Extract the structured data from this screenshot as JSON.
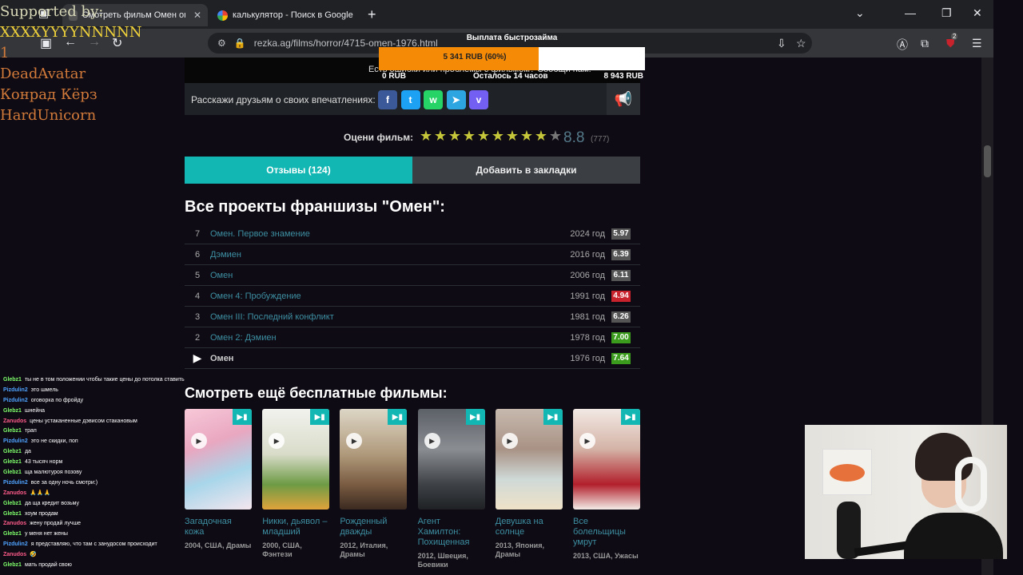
{
  "browser": {
    "tabs": [
      {
        "label": "Смотреть фильм Омен онлайн"
      },
      {
        "label": "калькулятор - Поиск в Google"
      }
    ],
    "new_tab": "+",
    "url": "rezka.ag/films/horror/4715-omen-1976.html",
    "extension_badge": "2"
  },
  "page": {
    "report_text": "Есть ошибки или проблемы с фильмом? Сообщи нам!",
    "share_label": "Расскажи друзьям о своих впечатлениях:",
    "social": [
      {
        "name": "facebook",
        "glyph": "f",
        "color": "#3b5998"
      },
      {
        "name": "twitter",
        "glyph": "t",
        "color": "#1da1f2"
      },
      {
        "name": "whatsapp",
        "glyph": "w",
        "color": "#25d366"
      },
      {
        "name": "telegram",
        "glyph": "➤",
        "color": "#2ca5e0"
      },
      {
        "name": "viber",
        "glyph": "v",
        "color": "#7360f2"
      }
    ],
    "rating_label": "Оцени фильм:",
    "rating_value": "8.8",
    "rating_count": "(777)",
    "rating_stars_filled": 9,
    "rating_stars_total": 10,
    "tab_reviews": "Отзывы (124)",
    "tab_bookmark": "Добавить в закладки",
    "franchise_title": "Все проекты франшизы \"Омен\":",
    "franchise": [
      {
        "num": "7",
        "title": "Омен. Первое знамение",
        "year": "2024 год",
        "score": "5.97",
        "color": "#555555"
      },
      {
        "num": "6",
        "title": "Дэмиен",
        "year": "2016 год",
        "score": "6.39",
        "color": "#555555"
      },
      {
        "num": "5",
        "title": "Омен",
        "year": "2006 год",
        "score": "6.11",
        "color": "#555555"
      },
      {
        "num": "4",
        "title": "Омен 4: Пробуждение",
        "year": "1991 год",
        "score": "4.94",
        "color": "#c8232c"
      },
      {
        "num": "3",
        "title": "Омен III: Последний конфликт",
        "year": "1981 год",
        "score": "6.26",
        "color": "#555555"
      },
      {
        "num": "2",
        "title": "Омен 2: Дэмиен",
        "year": "1978 год",
        "score": "7.00",
        "color": "#3a9b1c"
      },
      {
        "num": "▶",
        "title": "Омен",
        "year": "1976 год",
        "score": "7.64",
        "color": "#3a9b1c",
        "current": true
      }
    ],
    "more_title": "Смотреть ещё бесплатные фильмы:",
    "movies": [
      {
        "title": "Загадочная кожа",
        "meta": "2004, США, Драмы",
        "poster": "linear-gradient(160deg,#f7c8d8 0%,#e9a7c0 35%,#a8d6ea 65%,#f4e6ef 100%)"
      },
      {
        "title": "Никки, дьявол – младший",
        "meta": "2000, США, Фэнтези",
        "poster": "linear-gradient(180deg,#f2f2ee 0%,#d9dcc9 45%,#6d9b45 75%,#e0a33b 100%)"
      },
      {
        "title": "Рожденный дважды",
        "meta": "2012, Италия, Драмы",
        "poster": "linear-gradient(180deg,#ddd6c6 0%,#b09a7c 45%,#7a5c42 75%,#3b2a20 100%)"
      },
      {
        "title": "Агент Хамилтон: Похищенная",
        "meta": "2012, Швеция, Боевики",
        "poster": "linear-gradient(180deg,#5c6067 0%,#8a8d92 40%,#3e4146 75%,#1f2124 100%)"
      },
      {
        "title": "Девушка на солнце",
        "meta": "2013, Япония, Драмы",
        "poster": "linear-gradient(180deg,#c7b9ae 0%,#a99285 40%,#cfd9d7 70%,#efe2c8 100%)"
      },
      {
        "title": "Все болельщицы умрут",
        "meta": "2013, США, Ужасы",
        "poster": "linear-gradient(180deg,#f2e9e4 0%,#d4b3a6 40%,#b21f2b 75%,#f3ece7 100%)"
      }
    ]
  },
  "overlay": {
    "donation_title": "Выплата быстрозайма",
    "donation_amount": "5 341 RUB (60%)",
    "donation_progress": 0.6,
    "donation_min": "0 RUB",
    "donation_remaining": "Осталось 14 часов",
    "donation_max": "8 943 RUB",
    "supporters": [
      {
        "text": "Supported by:",
        "color": "#d8d8b8"
      },
      {
        "text": "XXXXYYYYNNNNN",
        "color": "#f0d23a"
      },
      {
        "text": "1",
        "color": "#d27a3a"
      },
      {
        "text": "DeadAvatar",
        "color": "#d27a3a"
      },
      {
        "text": "Конрад Кёрз",
        "color": "#d27a3a"
      },
      {
        "text": "HardUnicorn",
        "color": "#d27a3a"
      }
    ],
    "chat": [
      {
        "user": "Glebz1",
        "msg": "ты не в том положении чтобы такие цены до потолка ставить",
        "color": "#7fff6b"
      },
      {
        "user": "Pizdulin2",
        "msg": "это шмель",
        "color": "#4fa3ff"
      },
      {
        "user": "Pizdulin2",
        "msg": "оговорка по фройду",
        "color": "#4fa3ff"
      },
      {
        "user": "Glebz1",
        "msg": "шнейна",
        "color": "#7fff6b"
      },
      {
        "user": "Zanudos",
        "msg": "цены устаканенные дэвисом стакановым",
        "color": "#ff5c8a"
      },
      {
        "user": "Glebz1",
        "msg": "трап",
        "color": "#7fff6b"
      },
      {
        "user": "Pizdulin2",
        "msg": "это не скидки, поп",
        "color": "#4fa3ff"
      },
      {
        "user": "Glebz1",
        "msg": "да",
        "color": "#7fff6b"
      },
      {
        "user": "Glebz1",
        "msg": "43 тысяч норм",
        "color": "#7fff6b"
      },
      {
        "user": "Glebz1",
        "msg": "ща малютуроя позову",
        "color": "#7fff6b"
      },
      {
        "user": "Pizdulin2",
        "msg": "все за одну ночь смотри:)",
        "color": "#4fa3ff"
      },
      {
        "user": "Zanudos",
        "msg": "🙏🙏🙏",
        "color": "#ff5c8a"
      },
      {
        "user": "Glebz1",
        "msg": "да ща кредит возьму",
        "color": "#7fff6b"
      },
      {
        "user": "Glebz1",
        "msg": "хоум продам",
        "color": "#7fff6b"
      },
      {
        "user": "Zanudos",
        "msg": "жену продай лучше",
        "color": "#ff5c8a"
      },
      {
        "user": "Glebz1",
        "msg": "у меня нет жены",
        "color": "#7fff6b"
      },
      {
        "user": "Pizdulin2",
        "msg": "я представляю, что там с занудосом происходит",
        "color": "#4fa3ff"
      },
      {
        "user": "Zanudos",
        "msg": "🤣",
        "color": "#ff5c8a"
      },
      {
        "user": "Glebz1",
        "msg": "мать продай свою",
        "color": "#7fff6b"
      }
    ]
  }
}
